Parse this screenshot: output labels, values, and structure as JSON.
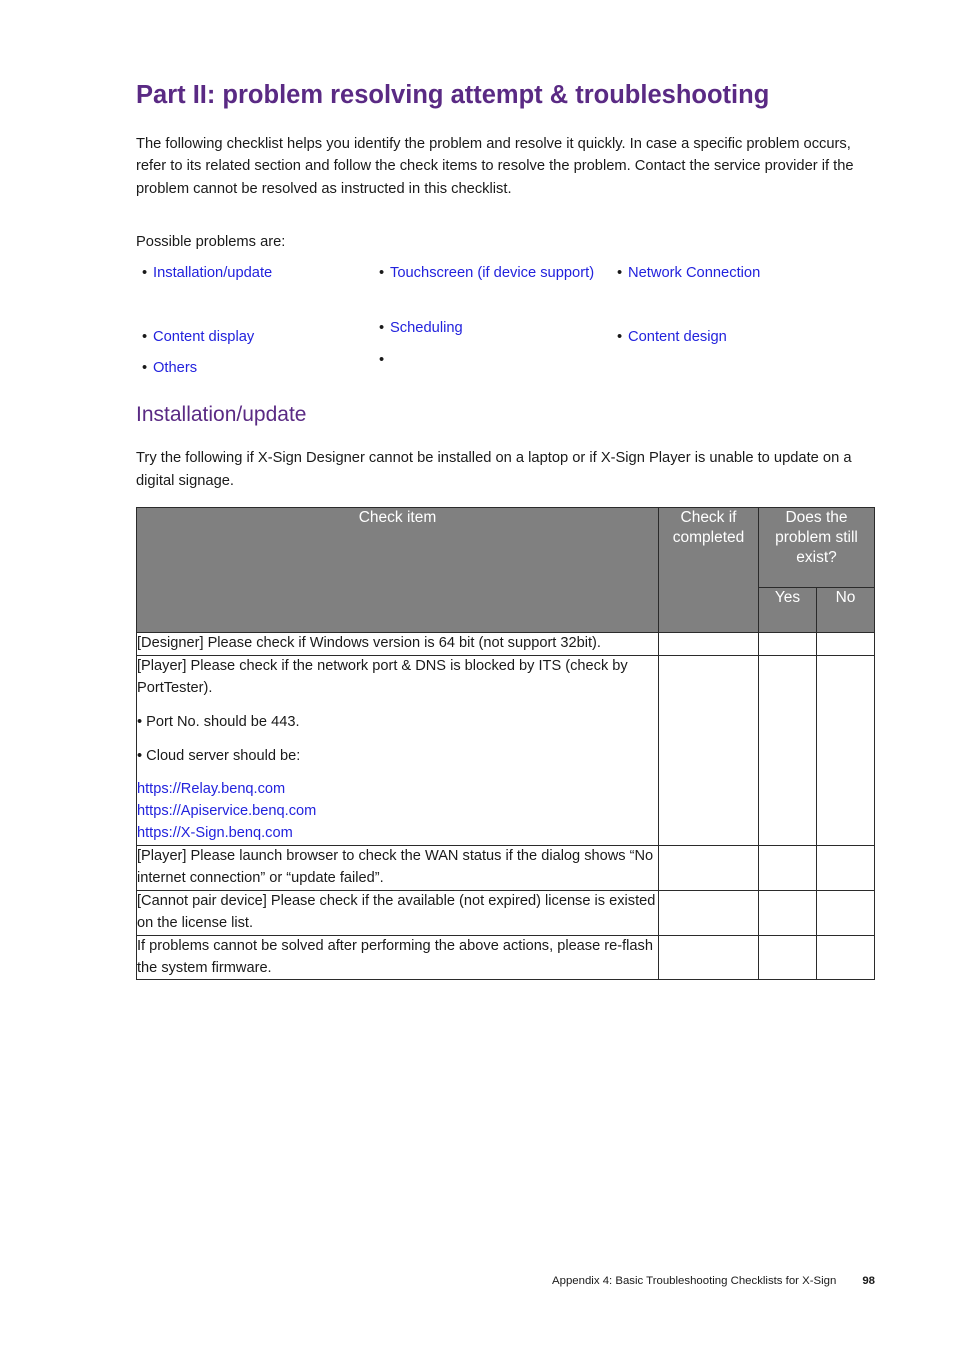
{
  "page": {
    "heading": "Part II: problem resolving attempt & troubleshooting",
    "intro": "The following checklist helps you identify the problem and resolve it quickly. In case a specific problem occurs, refer to its related section and follow the check items to resolve the problem. Contact the service provider if the problem cannot be resolved as instructed in this checklist.",
    "possible_label": "Possible problems are:",
    "section_heading": "Installation/update",
    "section_intro": "Try the following if X-Sign Designer cannot be installed on a laptop or if X-Sign Player is unable to update on a digital signage."
  },
  "bullets": {
    "marker": "•",
    "col1": [
      {
        "label": "Installation/update"
      },
      {
        "label": "Content display"
      },
      {
        "label": "Others"
      }
    ],
    "col2": [
      {
        "label": "Touchscreen (if device support)"
      },
      {
        "label": "Scheduling"
      },
      {
        "label": ""
      }
    ],
    "col3": [
      {
        "label": "Network Connection"
      },
      {
        "label": "Content design"
      }
    ]
  },
  "table": {
    "headers": {
      "check_item": "Check item",
      "check_if_completed": "Check if completed",
      "problem_exists": "Does the problem still exist?",
      "yes": "Yes",
      "no": "No"
    },
    "rows": [
      {
        "text": "[Designer] Please check if Windows version is 64 bit (not support 32bit).",
        "check_completed": "",
        "yes": "",
        "no": ""
      },
      {
        "text": "[Player] Please check if the network port & DNS is blocked by ITS (check by PortTester).",
        "sub_bullets": [
          "• Port No. should be 443.",
          "• Cloud server should be:"
        ],
        "urls": [
          "https://Relay.benq.com",
          "https://Apiservice.benq.com",
          "https://X-Sign.benq.com"
        ],
        "check_completed": "",
        "yes": "",
        "no": ""
      },
      {
        "text": "[Player] Please launch browser to check the WAN status if the dialog shows “No internet connection” or “update failed”.",
        "check_completed": "",
        "yes": "",
        "no": ""
      },
      {
        "text": "[Cannot pair device] Please check if the available (not expired) license is existed on the license list.",
        "check_completed": "",
        "yes": "",
        "no": ""
      },
      {
        "text": "If problems cannot be solved after performing the above actions, please re-flash the system firmware.",
        "check_completed": "",
        "yes": "",
        "no": ""
      }
    ]
  },
  "footer": {
    "text": "Appendix 4: Basic Troubleshooting Checklists for X-Sign",
    "page_number": "98"
  },
  "colors": {
    "heading_purple": "#5a2a84",
    "link_blue": "#2222dd",
    "table_header_gray": "#808080",
    "border": "#2b2b2b",
    "body_text": "#1a1a1a"
  }
}
